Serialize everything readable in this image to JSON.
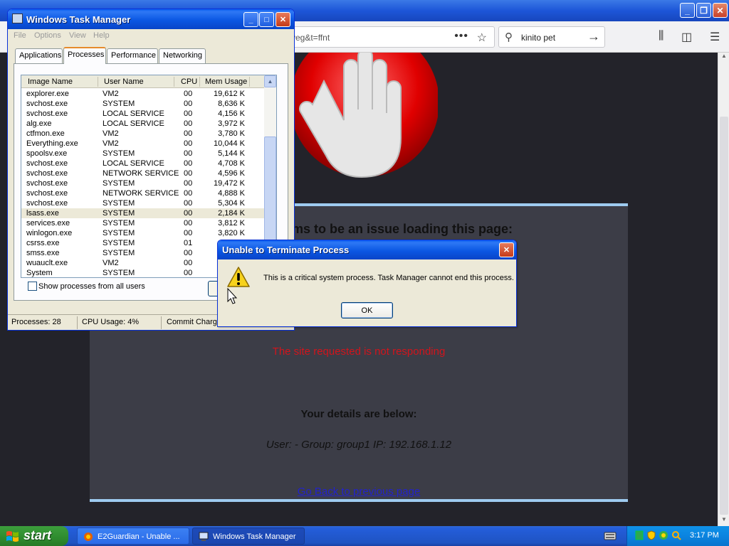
{
  "browser": {
    "url_fragment": "veg&t=ffnt",
    "search_value": "kinito pet"
  },
  "block_page": {
    "heading_partial": "ms to be an issue loading this page:",
    "error_text": "The site requested is not responding",
    "details_heading": "Your details are below:",
    "user_line": "User: -   Group: group1   IP: 192.168.1.12",
    "back_link": "Go Back to previous page"
  },
  "task_manager": {
    "title": "Windows Task Manager",
    "menu": [
      "File",
      "Options",
      "View",
      "Help"
    ],
    "tabs": [
      "Applications",
      "Processes",
      "Performance",
      "Networking"
    ],
    "active_tab": "Processes",
    "columns": [
      "Image Name",
      "User Name",
      "CPU",
      "Mem Usage"
    ],
    "processes": [
      {
        "name": "explorer.exe",
        "user": "VM2",
        "cpu": "00",
        "mem": "19,612 K"
      },
      {
        "name": "svchost.exe",
        "user": "SYSTEM",
        "cpu": "00",
        "mem": "8,636 K"
      },
      {
        "name": "svchost.exe",
        "user": "LOCAL SERVICE",
        "cpu": "00",
        "mem": "4,156 K"
      },
      {
        "name": "alg.exe",
        "user": "LOCAL SERVICE",
        "cpu": "00",
        "mem": "3,972 K"
      },
      {
        "name": "ctfmon.exe",
        "user": "VM2",
        "cpu": "00",
        "mem": "3,780 K"
      },
      {
        "name": "Everything.exe",
        "user": "VM2",
        "cpu": "00",
        "mem": "10,044 K"
      },
      {
        "name": "spoolsv.exe",
        "user": "SYSTEM",
        "cpu": "00",
        "mem": "5,144 K"
      },
      {
        "name": "svchost.exe",
        "user": "LOCAL SERVICE",
        "cpu": "00",
        "mem": "4,708 K"
      },
      {
        "name": "svchost.exe",
        "user": "NETWORK SERVICE",
        "cpu": "00",
        "mem": "4,596 K"
      },
      {
        "name": "svchost.exe",
        "user": "SYSTEM",
        "cpu": "00",
        "mem": "19,472 K"
      },
      {
        "name": "svchost.exe",
        "user": "NETWORK SERVICE",
        "cpu": "00",
        "mem": "4,888 K"
      },
      {
        "name": "svchost.exe",
        "user": "SYSTEM",
        "cpu": "00",
        "mem": "5,304 K"
      },
      {
        "name": "lsass.exe",
        "user": "SYSTEM",
        "cpu": "00",
        "mem": "2,184 K",
        "selected": true
      },
      {
        "name": "services.exe",
        "user": "SYSTEM",
        "cpu": "00",
        "mem": "3,812 K"
      },
      {
        "name": "winlogon.exe",
        "user": "SYSTEM",
        "cpu": "00",
        "mem": "3,820 K"
      },
      {
        "name": "csrss.exe",
        "user": "SYSTEM",
        "cpu": "01",
        "mem": ""
      },
      {
        "name": "smss.exe",
        "user": "SYSTEM",
        "cpu": "00",
        "mem": ""
      },
      {
        "name": "wuauclt.exe",
        "user": "VM2",
        "cpu": "00",
        "mem": ""
      },
      {
        "name": "System",
        "user": "SYSTEM",
        "cpu": "00",
        "mem": ""
      }
    ],
    "show_all_label": "Show processes from all users",
    "status": {
      "processes": "Processes: 28",
      "cpu": "CPU Usage: 4%",
      "commit": "Commit Charge"
    }
  },
  "dialog": {
    "title": "Unable to Terminate Process",
    "message": "This is a critical system process.  Task Manager cannot end this process.",
    "ok_label": "OK"
  },
  "taskbar": {
    "start_label": "start",
    "tasks": [
      {
        "label": "E2Guardian - Unable ...",
        "active": false
      },
      {
        "label": "Windows Task Manager",
        "active": true
      }
    ],
    "clock": "3:17 PM"
  },
  "colors": {
    "xp_blue": "#0b57e3",
    "start_green": "#2e8b2e",
    "error_red": "#d2141c"
  }
}
